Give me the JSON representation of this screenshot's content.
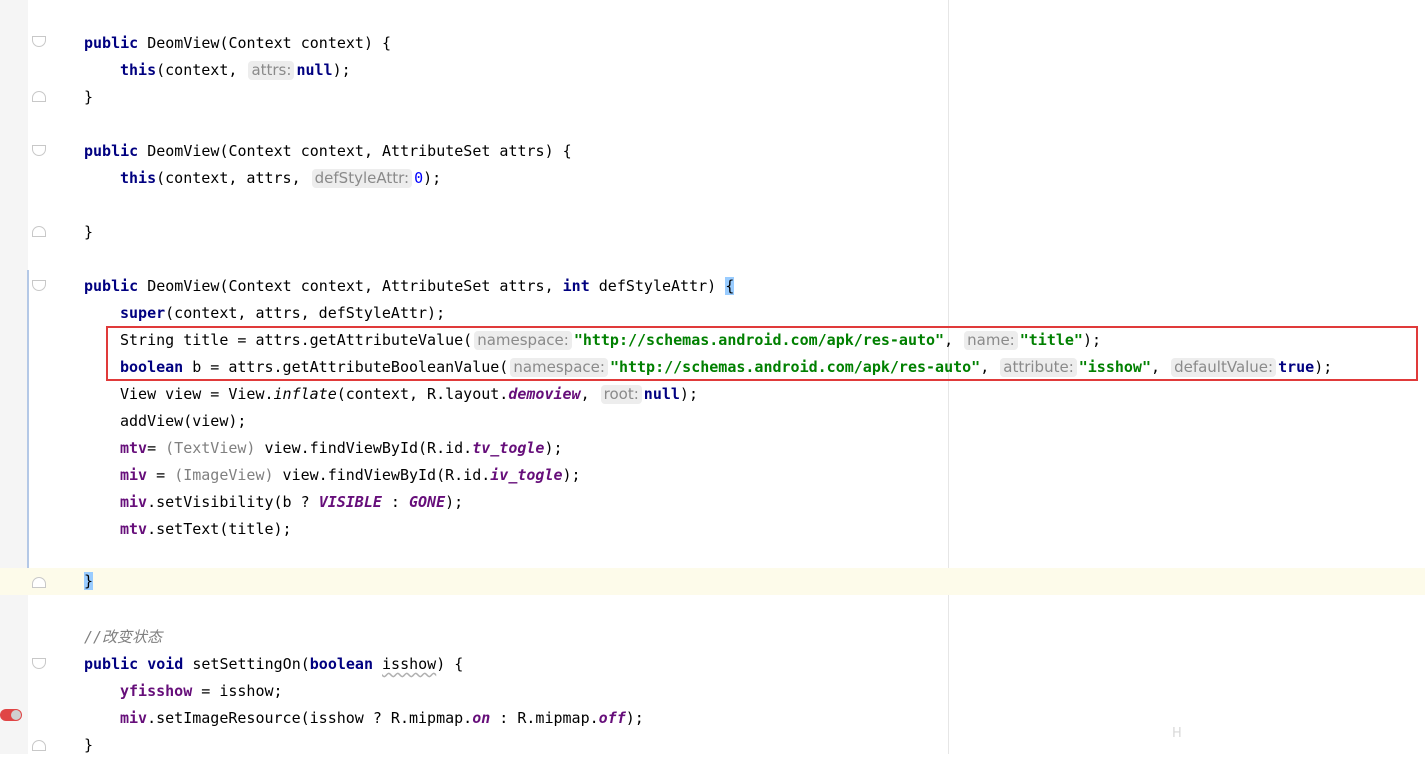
{
  "editor": {
    "lines": {
      "l1_public": "public",
      "l1_sig": "DeomView(Context context) {",
      "l2_this": "this",
      "l2_args": "(context, ",
      "l2_hint": "attrs:",
      "l2_null": "null",
      "l2_end": ");",
      "l3": "}",
      "l5_public": "public",
      "l5_sig": "DeomView(Context context, AttributeSet attrs) {",
      "l6_this": "this",
      "l6_args": "(context, attrs, ",
      "l6_hint": "defStyleAttr:",
      "l6_zero": "0",
      "l6_end": ");",
      "l8": "}",
      "l10_public": "public",
      "l10_sig_a": "DeomView(Context context, AttributeSet attrs, ",
      "l10_int": "int",
      "l10_sig_b": " defStyleAttr) ",
      "l10_brace": "{",
      "l11_super": "super",
      "l11_rest": "(context, attrs, defStyleAttr);",
      "l12_a": "String title = attrs.getAttributeValue(",
      "l12_hint1": "namespace:",
      "l12_str1": "\"http://schemas.android.com/apk/res-auto\"",
      "l12_comma": ", ",
      "l12_hint2": "name:",
      "l12_str2": "\"title\"",
      "l12_end": ");",
      "l13_bool": "boolean",
      "l13_a": " b = attrs.getAttributeBooleanValue(",
      "l13_hint1": "namespace:",
      "l13_str1": "\"http://schemas.android.com/apk/res-auto\"",
      "l13_comma1": ", ",
      "l13_hint2": "attribute:",
      "l13_str2": "\"isshow\"",
      "l13_comma2": ", ",
      "l13_hint3": "defaultValue:",
      "l13_true": "true",
      "l13_end": ");",
      "l14_a": "View view = View.",
      "l14_inflate": "inflate",
      "l14_b": "(context, R.layout.",
      "l14_demoview": "demoview",
      "l14_c": ", ",
      "l14_hint": "root:",
      "l14_null": "null",
      "l14_end": ");",
      "l15": "addView(view);",
      "l16_mtv": "mtv",
      "l16_a": "= ",
      "l16_cast": "(TextView)",
      "l16_b": " view.findViewById(R.id.",
      "l16_id": "tv_togle",
      "l16_end": ");",
      "l17_miv": "miv",
      "l17_a": " = ",
      "l17_cast": "(ImageView)",
      "l17_b": " view.findViewById(R.id.",
      "l17_id": "iv_togle",
      "l17_end": ");",
      "l18_miv": "miv",
      "l18_a": ".setVisibility(b ? ",
      "l18_visible": "VISIBLE",
      "l18_b": " : ",
      "l18_gone": "GONE",
      "l18_end": ");",
      "l19_mtv": "mtv",
      "l19_a": ".setText(title);",
      "l21": "}",
      "l23_comment": "//改变状态",
      "l24_public": "public",
      "l24_void": "void",
      "l24_a": " setSettingOn(",
      "l24_bool": "boolean",
      "l24_b": " ",
      "l24_param": "isshow",
      "l24_end": ") {",
      "l25_field": "yfisshow",
      "l25_a": " = isshow;",
      "l26_miv": "miv",
      "l26_a": ".setImageResource(isshow ? R.mipmap.",
      "l26_on": "on",
      "l26_b": " : R.mipmap.",
      "l26_off": "off",
      "l26_end": ");",
      "l27": "}"
    },
    "watermark": "H"
  },
  "colors": {
    "keyword": "#000080",
    "string": "#008000",
    "field": "#660e7a",
    "comment": "#808080",
    "highlight_box": "#e03a3a",
    "caret_line": "#fdfbea"
  }
}
